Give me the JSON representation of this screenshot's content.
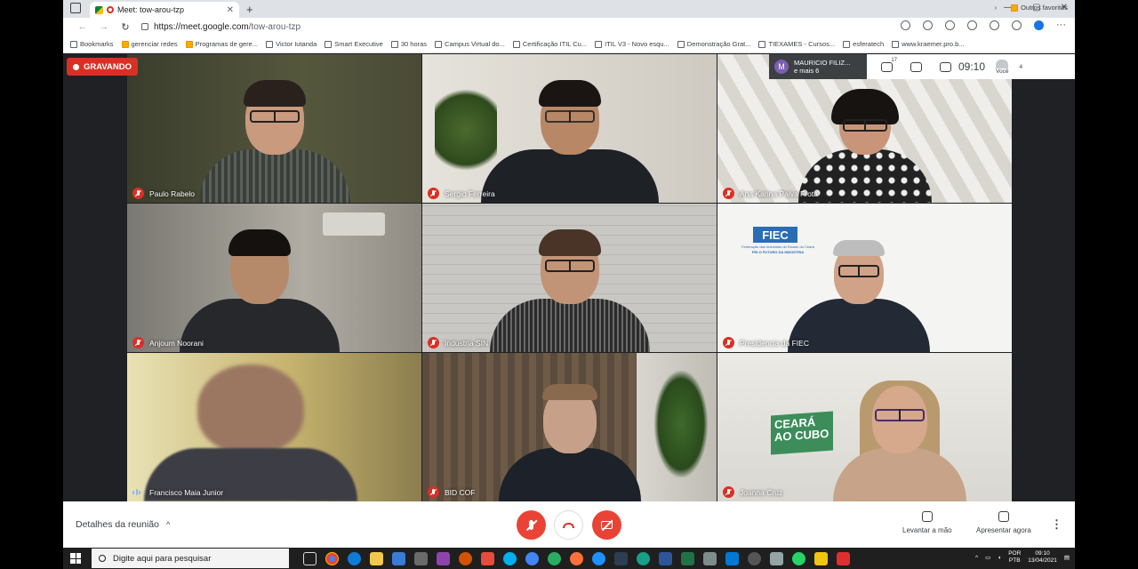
{
  "browser": {
    "tab_title": "Meet: tow-arou-tzp",
    "tab_close": "✕",
    "new_tab": "+",
    "window_controls": [
      "—",
      "▢",
      "✕"
    ],
    "url_domain": "https://meet.google.com",
    "url_path": "/tow-arou-tzp"
  },
  "bookmarks": [
    {
      "label": "Bookmarks",
      "folder": false
    },
    {
      "label": "gerenciar redes",
      "folder": true
    },
    {
      "label": "Programas de gere...",
      "folder": true
    },
    {
      "label": "Victor Iutanda",
      "folder": false
    },
    {
      "label": "Smart Executive",
      "folder": false
    },
    {
      "label": "30 horas",
      "folder": false
    },
    {
      "label": "Campus Virtual do...",
      "folder": false
    },
    {
      "label": "Certificação ITIL Cu...",
      "folder": false
    },
    {
      "label": "ITIL V3 - Novo esqu...",
      "folder": false
    },
    {
      "label": "Demonstração Grat...",
      "folder": false
    },
    {
      "label": "TIEXAMES - Cursos...",
      "folder": false
    },
    {
      "label": "esferatech",
      "folder": false
    },
    {
      "label": "www.kraemer.pro.b...",
      "folder": false
    }
  ],
  "bookmarks_more": "›",
  "bookmarks_other": "Outros favoritos",
  "meet": {
    "recording_label": "GRAVANDO",
    "presenter_initial": "M",
    "presenter_name": "MAURICIO FILIZ...",
    "presenter_more": "e mais 6",
    "participants_count": "17",
    "clock": "09:10",
    "you_label": "Você",
    "you_badge": "4"
  },
  "participants": [
    {
      "name": "Paulo Rabelo",
      "muted": true
    },
    {
      "name": "Sergio Ferreira",
      "muted": true
    },
    {
      "name": "Ana Karina Paiva Frota",
      "muted": true
    },
    {
      "name": "Anjoum Noorani",
      "muted": true
    },
    {
      "name": "Industria SIN",
      "muted": true
    },
    {
      "name": "Presidencia da FIEC",
      "muted": true
    },
    {
      "name": "Francisco Maia Junior",
      "muted": false
    },
    {
      "name": "BID COF",
      "muted": true
    },
    {
      "name": "Joanna Cruz",
      "muted": true
    }
  ],
  "tile_text": {
    "fiec_logo": "FIEC",
    "fiec_subtitle": "Federação das Indústrias do Estado do Ceará",
    "fiec_tagline": "PELO FUTURO DA INDÚSTRIA",
    "ceara_banner": "CEARÁ AO CUBO"
  },
  "controls": {
    "details_label": "Detalhes da reunião",
    "details_chevron": "^",
    "raise_hand": "Levantar a mão",
    "present_now": "Apresentar agora",
    "more": "⋮"
  },
  "taskbar": {
    "search_placeholder": "Digite aqui para pesquisar",
    "lang_top": "POR",
    "lang_bottom": "PTB",
    "time": "09:10",
    "date": "13/04/2021"
  },
  "colors": {
    "accent_red": "#d93025",
    "meet_bg": "#202124",
    "fiec_blue": "#2a6db5"
  }
}
